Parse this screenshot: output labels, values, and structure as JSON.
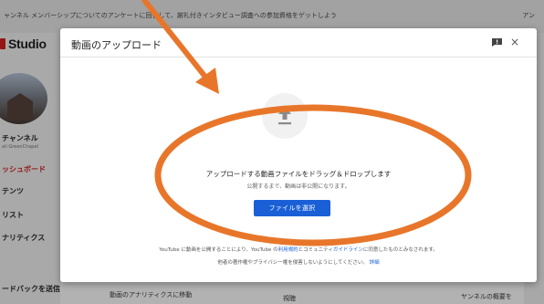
{
  "background": {
    "banner": "ャンネル メンバーシップについてのアンケートに回答して、謝礼付きインタビュー調査への参加資格をゲットしよう",
    "banner_right": "アン",
    "logo": "Studio",
    "channel_name": "チャンネル",
    "channel_handle": "ali GreenChapel",
    "sidebar": [
      {
        "label": "ッシュボード",
        "active": true
      },
      {
        "label": "テンツ",
        "active": false
      },
      {
        "label": "リスト",
        "active": false
      },
      {
        "label": "ナリティクス",
        "active": false
      },
      {
        "label": "ードバックを送信",
        "active": false
      }
    ],
    "bottom_link": "動画のアナリティクスに移動",
    "bottom_mid": "視聴",
    "bottom_right": "ヤンネルの概要を"
  },
  "dialog": {
    "title": "動画のアップロード",
    "feedback_icon": "feedback-icon",
    "close_icon": "close-icon",
    "close_glyph": "×",
    "upload_icon": "upload-arrow-icon",
    "drop_text": "アップロードする動画ファイルをドラッグ＆ドロップします",
    "drop_subtext": "公開するまで、動画は非公開になります。",
    "select_button": "ファイルを選択",
    "terms": {
      "prefix": "YouTube に動画を公開することにより、YouTube の",
      "tos_link": "利用規約",
      "middle": "とコミュニティ",
      "guidelines_link": "ガイドライン",
      "suffix": "に同意したものとみなされます。",
      "line2": "他者の著作権やプライバシー権を侵害しないようにしてください。",
      "learn_more": "詳細"
    }
  },
  "annotation": {
    "color": "#e8762a"
  }
}
